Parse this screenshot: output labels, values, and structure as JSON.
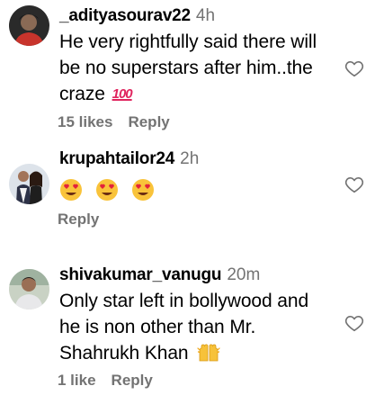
{
  "comments": [
    {
      "username": "_adityasourav22",
      "time": "4h",
      "text": "He very rightfully said there will be no superstars after him..the craze",
      "emoji": "100",
      "likes": "15 likes",
      "reply": "Reply"
    },
    {
      "username": "krupahtailor24",
      "time": "2h",
      "emoji": "heart-eyes-face x3",
      "reply": "Reply"
    },
    {
      "username": "shivakumar_vanugu",
      "time": "20m",
      "text": "Only star left in bollywood and he is non other than Mr. Shahrukh Khan",
      "emoji": "raising-hands",
      "likes": "1 like",
      "reply": "Reply"
    }
  ]
}
